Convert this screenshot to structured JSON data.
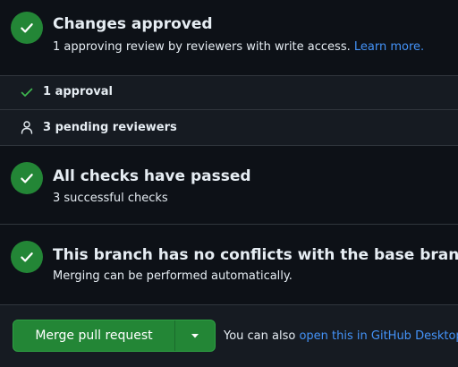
{
  "approval": {
    "title": "Changes approved",
    "subtitle_prefix": "1 approving review by reviewers with write access. ",
    "learn_more": "Learn more."
  },
  "approvals_row": {
    "label": "1 approval"
  },
  "pending_row": {
    "label": "3 pending reviewers"
  },
  "checks": {
    "title": "All checks have passed",
    "subtitle": "3 successful checks"
  },
  "conflicts": {
    "title": "This branch has no conflicts with the base branch",
    "subtitle": "Merging can be performed automatically."
  },
  "merge": {
    "button_label": "Merge pull request",
    "note_prefix": "You can also ",
    "desktop_link": "open this in GitHub Desktop"
  },
  "colors": {
    "success_green": "#238636",
    "link_blue": "#4493f8",
    "background": "#0d1117"
  },
  "icons": {
    "status": "check-circle-icon",
    "approval": "check-icon",
    "pending": "person-icon",
    "dropdown": "triangle-down-icon"
  }
}
